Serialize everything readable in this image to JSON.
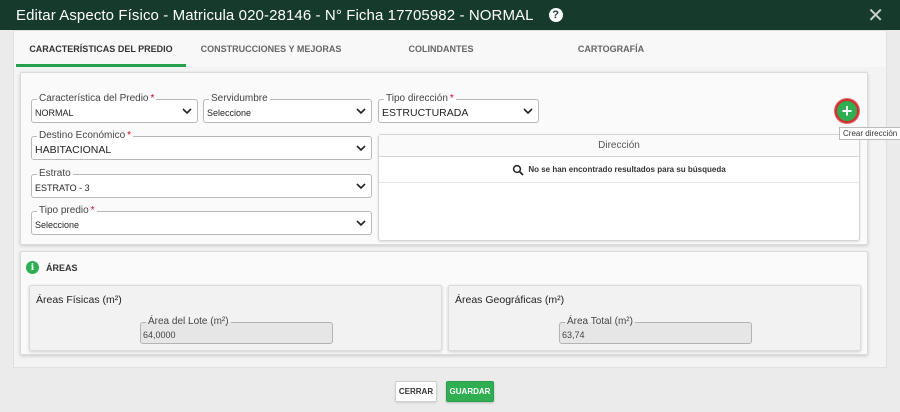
{
  "dialog": {
    "title": "Editar Aspecto Físico - Matricula 020-28146 - N° Ficha 17705982 - NORMAL",
    "help_icon": "question-circle-icon",
    "close_symbol": "✕"
  },
  "tabs": [
    {
      "label": "CARACTERÍSTICAS DEL PREDIO",
      "active": true
    },
    {
      "label": "CONSTRUCCIONES Y MEJORAS",
      "active": false
    },
    {
      "label": "COLINDANTES",
      "active": false
    },
    {
      "label": "CARTOGRAFÍA",
      "active": false
    }
  ],
  "form": {
    "caracteristica": {
      "label": "Característica del Predio",
      "required": "*",
      "value": "NORMAL"
    },
    "servidumbre": {
      "label": "Servidumbre",
      "value": "Seleccione"
    },
    "tipo_direccion": {
      "label": "Tipo dirección",
      "required": "*",
      "value": "ESTRUCTURADA"
    },
    "destino": {
      "label": "Destino Económico",
      "required": "*",
      "value": "HABITACIONAL"
    },
    "estrato": {
      "label": "Estrato",
      "value": "ESTRATO - 3"
    },
    "tipo_predio": {
      "label": "Tipo predio",
      "required": "*",
      "value": "Seleccione"
    }
  },
  "direccion_table": {
    "header": "Dirección",
    "empty_message": "No se han encontrado resultados para su búsqueda"
  },
  "add_button": {
    "symbol": "+",
    "tooltip": "Crear dirección"
  },
  "areas": {
    "title": "ÁREAS",
    "info_symbol": "i",
    "fisicas": {
      "title": "Áreas Físicas (m²)",
      "field_label": "Área del Lote (m²)",
      "value": "64,0000"
    },
    "geograficas": {
      "title": "Áreas Geográficas (m²)",
      "field_label": "Área Total (m²)",
      "value": "63,74"
    }
  },
  "footer": {
    "cancel_label": "CERRAR",
    "save_label": "GUARDAR"
  },
  "colors": {
    "header_bg": "#163a2c",
    "accent_green": "#2fae52",
    "required_red": "#d0021b"
  }
}
